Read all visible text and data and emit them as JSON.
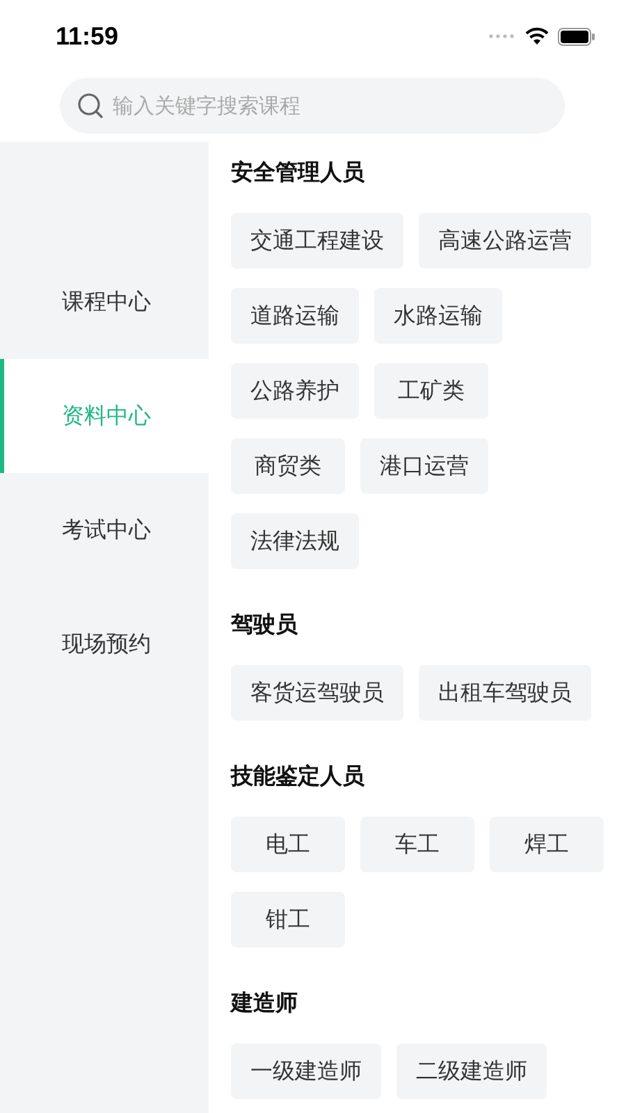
{
  "status_bar": {
    "time": "11:59"
  },
  "search": {
    "placeholder": "输入关键字搜索课程"
  },
  "sidebar": {
    "items": [
      {
        "label": "课程中心",
        "selected": false
      },
      {
        "label": "资料中心",
        "selected": true
      },
      {
        "label": "考试中心",
        "selected": false
      },
      {
        "label": "现场预约",
        "selected": false
      }
    ]
  },
  "sections": [
    {
      "title": "安全管理人员",
      "tags": [
        "交通工程建设",
        "高速公路运营",
        "道路运输",
        "水路运输",
        "公路养护",
        "工矿类",
        "商贸类",
        "港口运营",
        "法律法规"
      ]
    },
    {
      "title": "驾驶员",
      "tags": [
        "客货运驾驶员",
        "出租车驾驶员"
      ]
    },
    {
      "title": "技能鉴定人员",
      "tags": [
        "电工",
        "车工",
        "焊工",
        "钳工"
      ]
    },
    {
      "title": "建造师",
      "tags": [
        "一级建造师",
        "二级建造师"
      ]
    }
  ]
}
